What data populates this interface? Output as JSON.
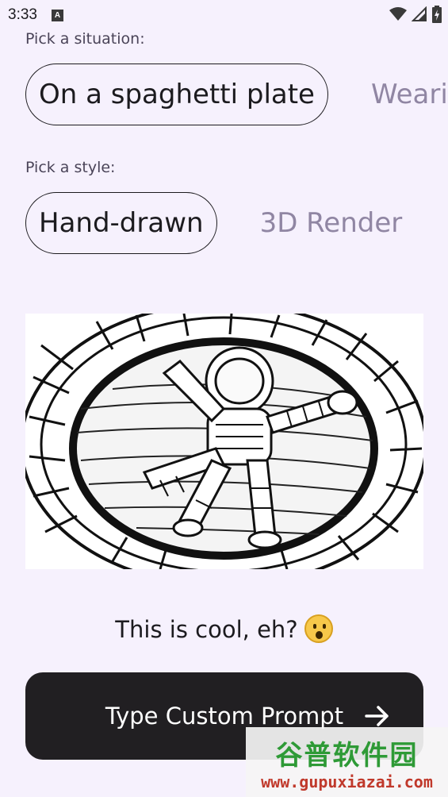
{
  "status_bar": {
    "time": "3:33",
    "notification_icon_letter": "A",
    "icons": [
      "wifi-icon",
      "signal-icon",
      "battery-icon"
    ]
  },
  "situation": {
    "label": "Pick a situation:",
    "selected": "On a spaghetti plate",
    "next": "Wearin"
  },
  "style": {
    "label": "Pick a style:",
    "selected": "Hand-drawn",
    "next": "3D Render"
  },
  "image": {
    "subject": "hand-drawn astronaut on a spaghetti plate"
  },
  "caption": {
    "text": "This is cool, eh?",
    "emoji": "astonished-face"
  },
  "cta": {
    "label": "Type Custom Prompt",
    "icon": "arrow-right-icon"
  },
  "watermark": {
    "title": "谷普软件园",
    "url": "www.gupuxiazai.com"
  },
  "colors": {
    "background": "#f6f1fd",
    "button": "#211f22",
    "muted_chip_text": "#9086a3"
  }
}
